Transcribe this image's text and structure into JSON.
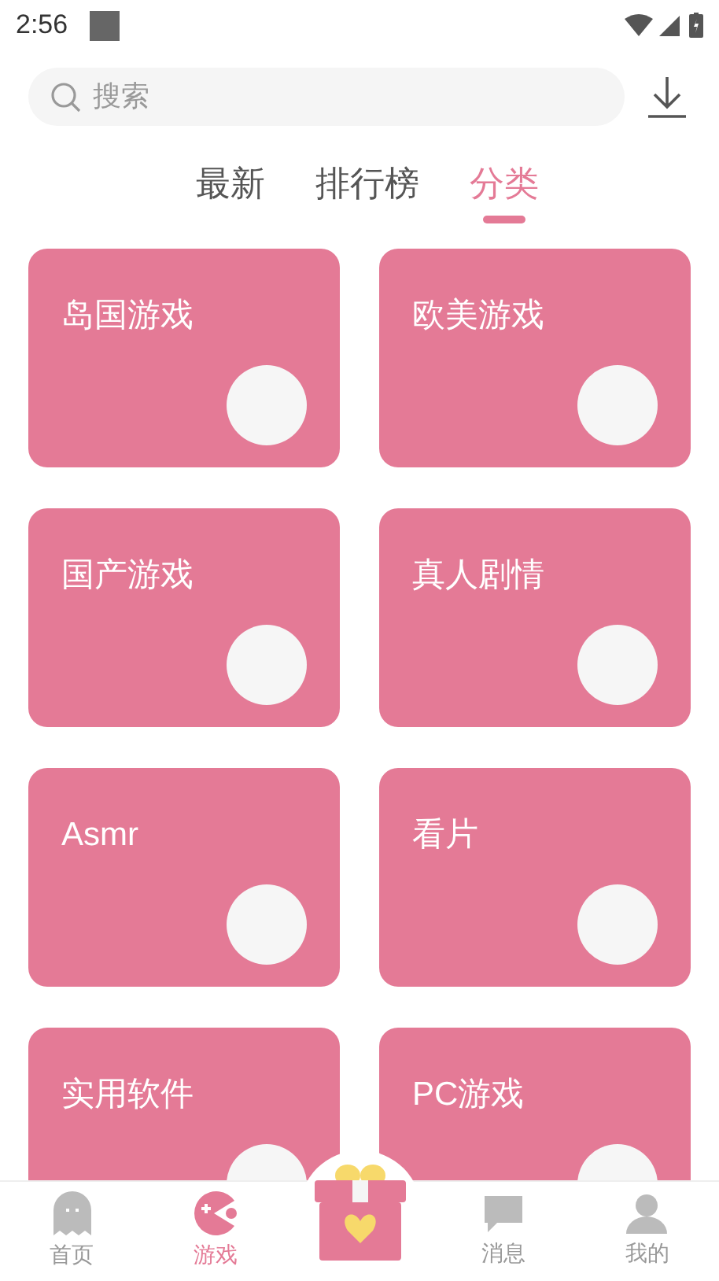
{
  "status_bar": {
    "time": "2:56"
  },
  "search": {
    "placeholder": "搜索"
  },
  "tabs": [
    {
      "label": "最新",
      "selected": false
    },
    {
      "label": "排行榜",
      "selected": false
    },
    {
      "label": "分类",
      "selected": true
    }
  ],
  "categories": [
    {
      "title": "岛国游戏"
    },
    {
      "title": "欧美游戏"
    },
    {
      "title": "国产游戏"
    },
    {
      "title": "真人剧情"
    },
    {
      "title": "Asmr"
    },
    {
      "title": "看片"
    },
    {
      "title": "实用软件"
    },
    {
      "title": "PC游戏"
    }
  ],
  "bottom_nav": [
    {
      "kind": "ghost",
      "label": "首页",
      "selected": false
    },
    {
      "kind": "game",
      "label": "游戏",
      "selected": true
    },
    {
      "kind": "gift",
      "selected": false
    },
    {
      "kind": "message",
      "label": "消息",
      "selected": false
    },
    {
      "kind": "user",
      "label": "我的",
      "selected": false
    }
  ]
}
